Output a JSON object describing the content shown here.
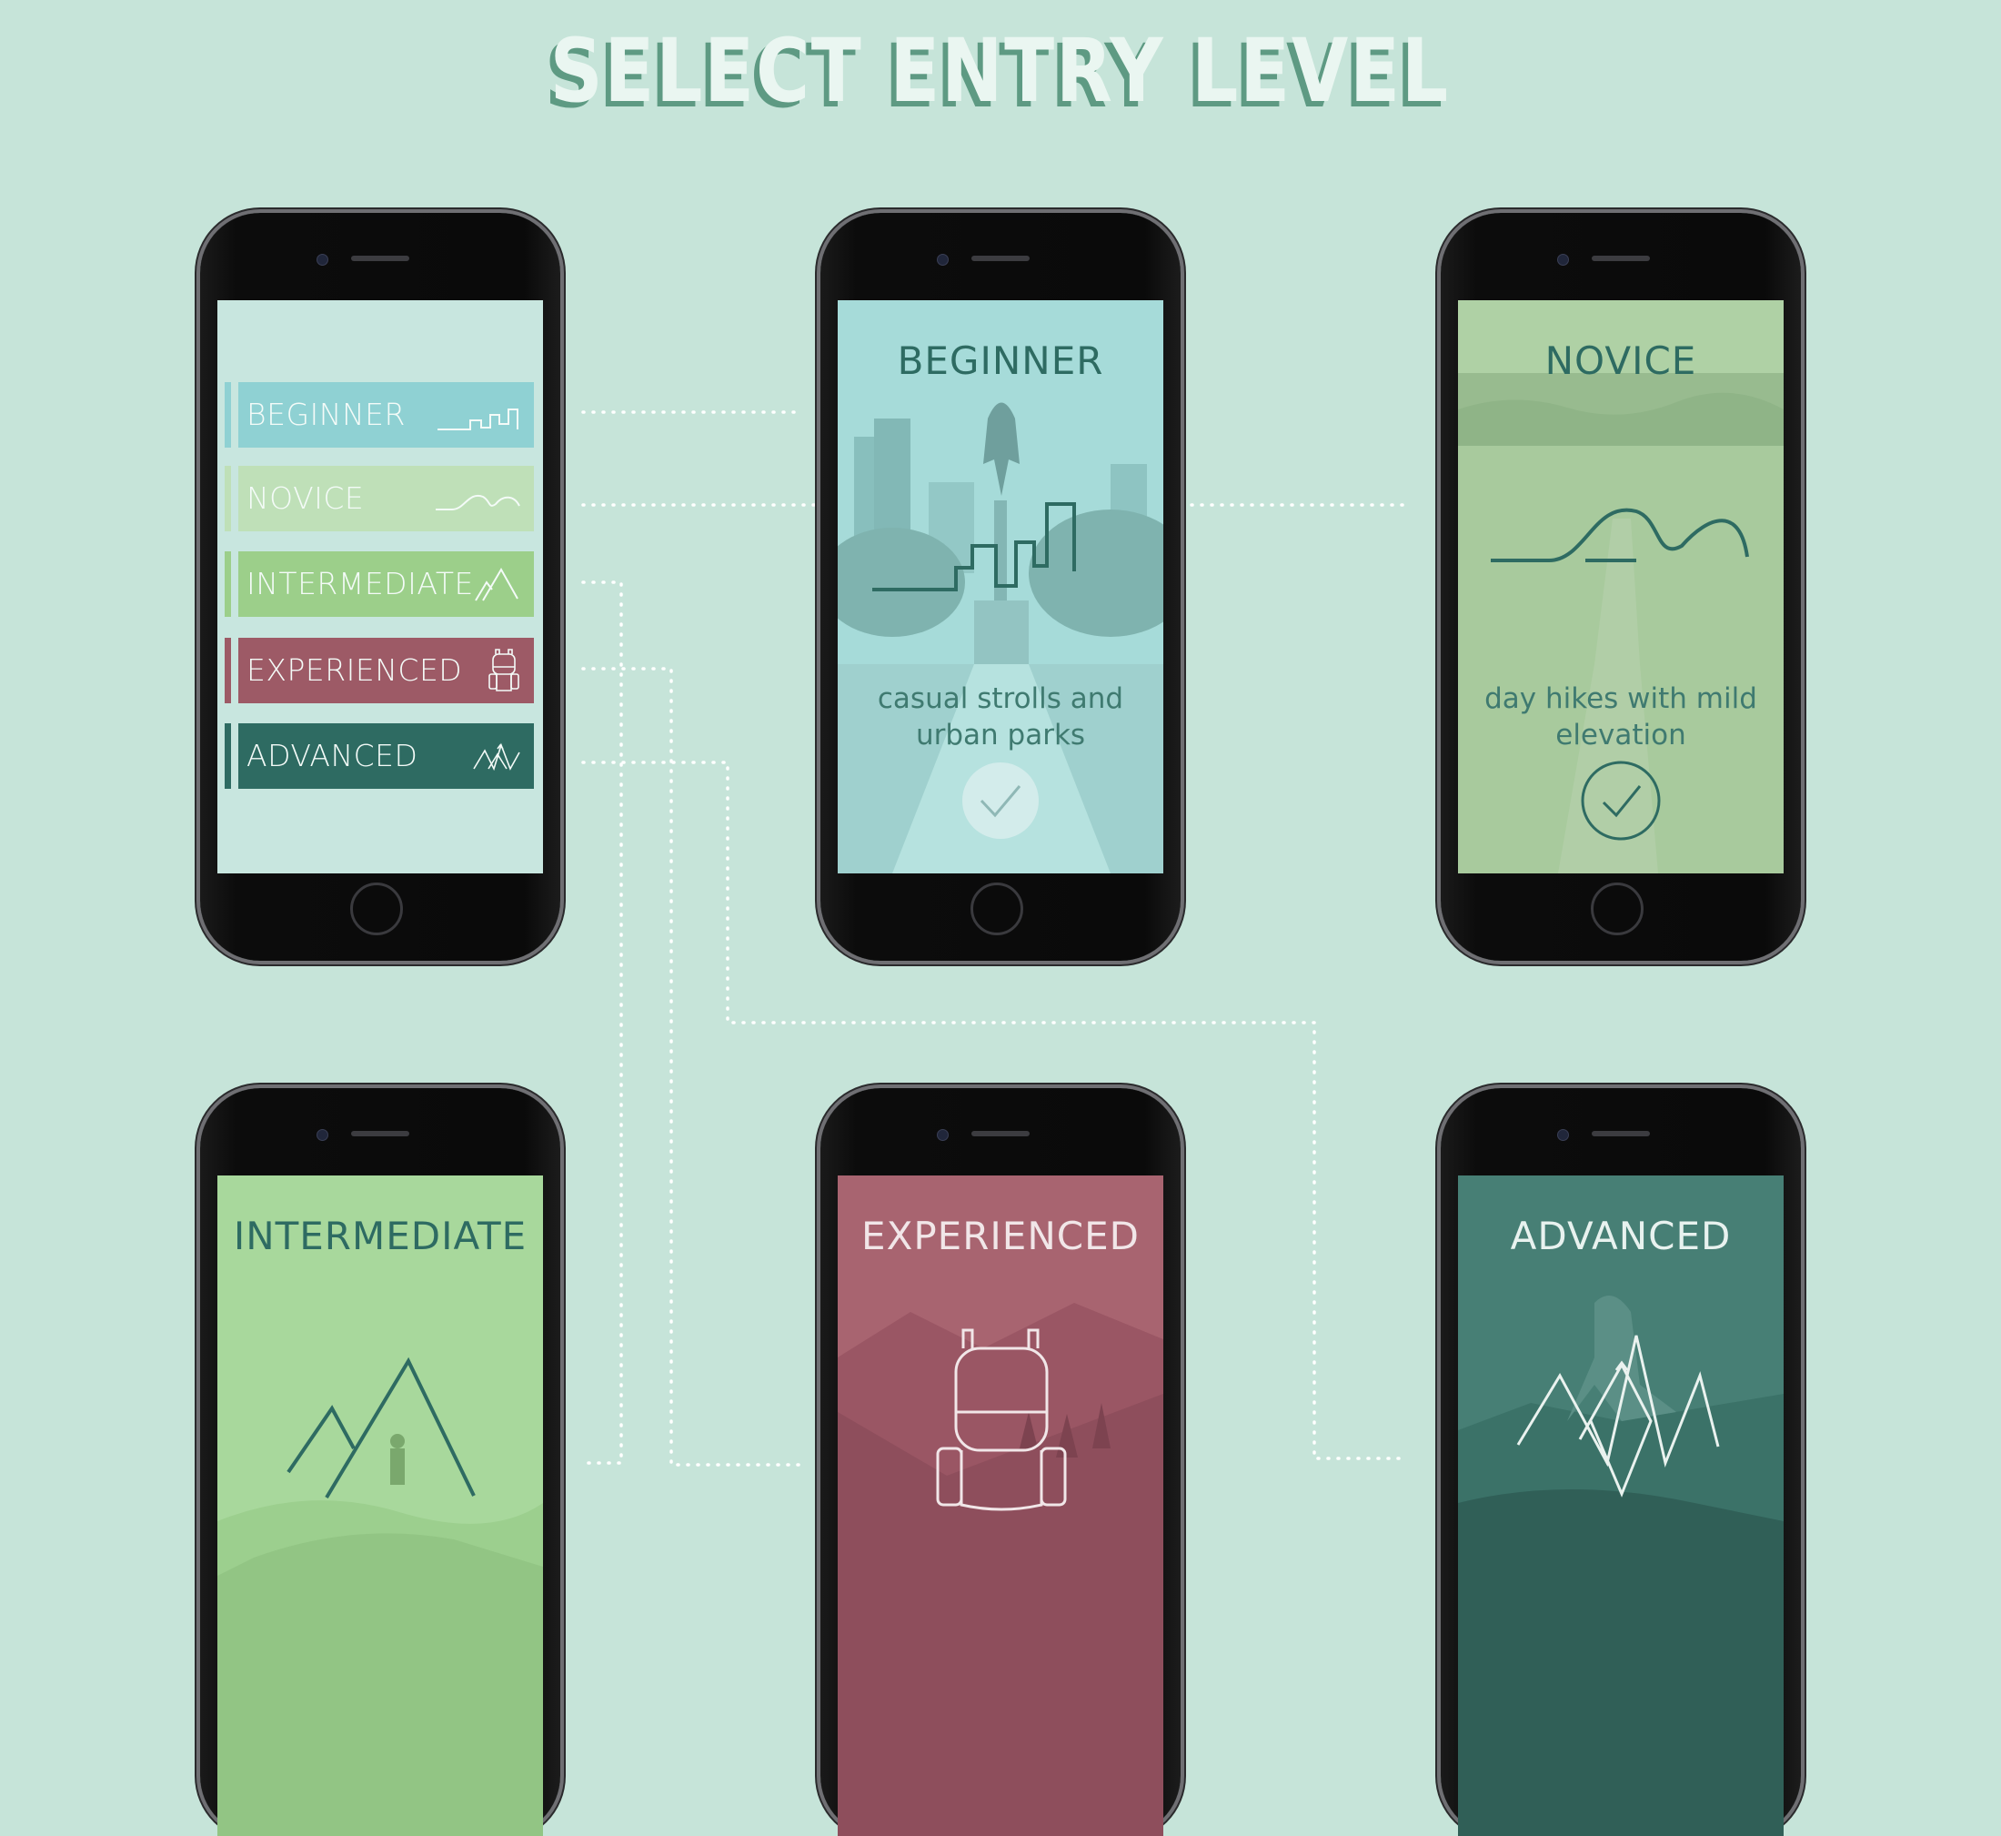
{
  "page": {
    "title": "SELECT ENTRY LEVEL"
  },
  "menu": {
    "items": [
      {
        "label": "BEGINNER",
        "icon": "city-skyline-icon",
        "color": "#8fd1d3"
      },
      {
        "label": "NOVICE",
        "icon": "rolling-hills-icon",
        "color": "#bfe0b8"
      },
      {
        "label": "INTERMEDIATE",
        "icon": "mountain-peaks-icon",
        "color": "#9ccf8a"
      },
      {
        "label": "EXPERIENCED",
        "icon": "backpack-icon",
        "color": "#9d5a66"
      },
      {
        "label": "ADVANCED",
        "icon": "summit-peaks-icon",
        "color": "#2e6b62"
      }
    ]
  },
  "beginner": {
    "title": "BEGINNER",
    "desc_line1": "casual strolls and",
    "desc_line2": "urban parks",
    "icon": "city-skyline-icon",
    "check": "checkmark-icon"
  },
  "novice": {
    "title": "NOVICE",
    "desc_line1": "day hikes with mild",
    "desc_line2": "elevation",
    "icon": "rolling-hills-icon",
    "check": "checkmark-icon"
  },
  "intermediate": {
    "title": "INTERMEDIATE",
    "icon": "mountain-peaks-icon"
  },
  "experienced": {
    "title": "EXPERIENCED",
    "icon": "backpack-icon"
  },
  "advanced": {
    "title": "ADVANCED",
    "icon": "summit-peaks-icon"
  }
}
